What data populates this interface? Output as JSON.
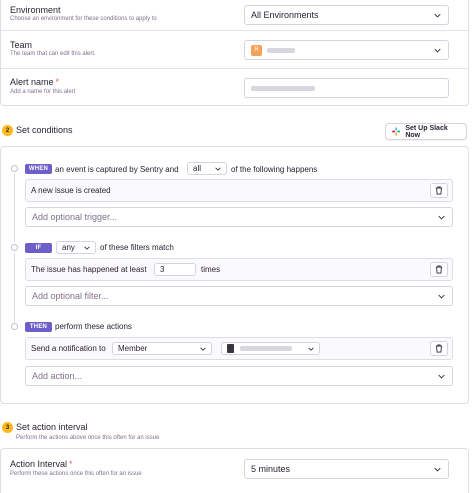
{
  "settings": {
    "environment": {
      "label": "Environment",
      "help": "Choose an environment for these conditions to apply to",
      "value": "All Environments"
    },
    "team": {
      "label": "Team",
      "help": "The team that can edit this alert.",
      "avatar_letter": "R"
    },
    "alert_name": {
      "label": "Alert name",
      "required_mark": "*",
      "help": "Add a name for this alert"
    }
  },
  "conditions": {
    "step_number": "2",
    "title": "Set conditions",
    "slack_button": "Set Up Slack Now",
    "when": {
      "badge": "WHEN",
      "text_before": "an event is captured by Sentry and",
      "match_value": "all",
      "text_after": "of the following happens",
      "items": [
        {
          "text": "A new issue is created"
        }
      ],
      "add_placeholder": "Add optional trigger..."
    },
    "if": {
      "badge": "IF",
      "match_value": "any",
      "text_after": "of these filters match",
      "filter_prefix": "The issue has happened at least",
      "filter_count": "3",
      "filter_suffix": "times",
      "add_placeholder": "Add optional filter..."
    },
    "then": {
      "badge": "THEN",
      "text_after": "perform these actions",
      "action_prefix": "Send a notification to",
      "target_type": "Member",
      "add_placeholder": "Add action..."
    }
  },
  "interval": {
    "step_number": "3",
    "title": "Set action interval",
    "subtitle": "Perform the actions above once this often for an issue",
    "field_label": "Action Interval",
    "required_mark": "*",
    "field_help": "Perform these actions once this often for an issue",
    "value": "5 minutes"
  },
  "colors": {
    "accent": "#6c5fc7",
    "step_badge": "#fdb81b",
    "required": "#f55459",
    "border": "#e0dce5"
  },
  "icons": [
    "chevron-down-icon",
    "trash-icon",
    "slack-icon",
    "step-badge"
  ]
}
